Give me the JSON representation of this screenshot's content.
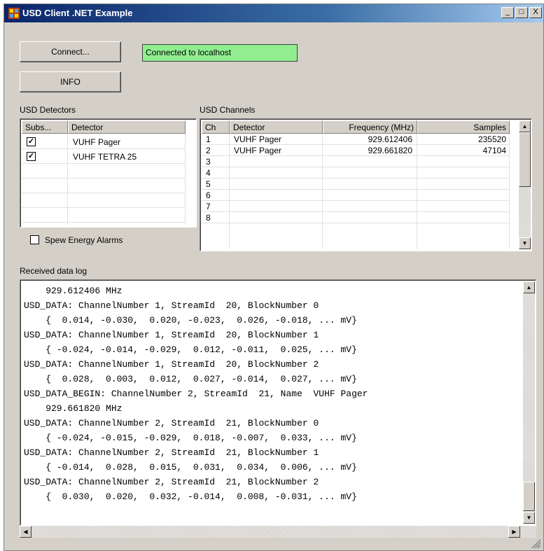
{
  "window": {
    "title": "USD Client .NET Example",
    "min": "_",
    "max": "□",
    "close": "X"
  },
  "buttons": {
    "connect": "Connect...",
    "info": "INFO"
  },
  "status": {
    "text": "Connected to localhost",
    "color": "#90ee90"
  },
  "detectors": {
    "label": "USD Detectors",
    "headers": [
      "Subs...",
      "Detector"
    ],
    "rows": [
      {
        "checked": true,
        "name": "VUHF Pager"
      },
      {
        "checked": true,
        "name": "VUHF TETRA 25"
      }
    ]
  },
  "spew": {
    "label": "Spew Energy Alarms",
    "checked": false
  },
  "channels": {
    "label": "USD Channels",
    "headers": [
      "Ch",
      "Detector",
      "Frequency (MHz)",
      "Samples"
    ],
    "rows": [
      {
        "ch": "1",
        "detector": "VUHF Pager",
        "freq": "929.612406",
        "samples": "235520"
      },
      {
        "ch": "2",
        "detector": "VUHF Pager",
        "freq": "929.661820",
        "samples": "47104"
      },
      {
        "ch": "3",
        "detector": "",
        "freq": "",
        "samples": ""
      },
      {
        "ch": "4",
        "detector": "",
        "freq": "",
        "samples": ""
      },
      {
        "ch": "5",
        "detector": "",
        "freq": "",
        "samples": ""
      },
      {
        "ch": "6",
        "detector": "",
        "freq": "",
        "samples": ""
      },
      {
        "ch": "7",
        "detector": "",
        "freq": "",
        "samples": ""
      },
      {
        "ch": "8",
        "detector": "",
        "freq": "",
        "samples": ""
      }
    ]
  },
  "log": {
    "label": "Received data log",
    "lines": [
      "    929.612406 MHz",
      "USD_DATA: ChannelNumber 1, StreamId  20, BlockNumber 0",
      "    {  0.014, -0.030,  0.020, -0.023,  0.026, -0.018, ... mV}",
      "USD_DATA: ChannelNumber 1, StreamId  20, BlockNumber 1",
      "    { -0.024, -0.014, -0.029,  0.012, -0.011,  0.025, ... mV}",
      "USD_DATA: ChannelNumber 1, StreamId  20, BlockNumber 2",
      "    {  0.028,  0.003,  0.012,  0.027, -0.014,  0.027, ... mV}",
      "USD_DATA_BEGIN: ChannelNumber 2, StreamId  21, Name  VUHF Pager",
      "    929.661820 MHz",
      "USD_DATA: ChannelNumber 2, StreamId  21, BlockNumber 0",
      "    { -0.024, -0.015, -0.029,  0.018, -0.007,  0.033, ... mV}",
      "USD_DATA: ChannelNumber 2, StreamId  21, BlockNumber 1",
      "    { -0.014,  0.028,  0.015,  0.031,  0.034,  0.006, ... mV}",
      "USD_DATA: ChannelNumber 2, StreamId  21, BlockNumber 2",
      "    {  0.030,  0.020,  0.032, -0.014,  0.008, -0.031, ... mV}"
    ]
  },
  "icons": [
    "app-icon",
    "minimize-icon",
    "maximize-icon",
    "close-icon",
    "checkbox-icon",
    "scroll-up-icon",
    "scroll-down-icon",
    "scroll-left-icon",
    "scroll-right-icon",
    "size-grip-icon"
  ]
}
